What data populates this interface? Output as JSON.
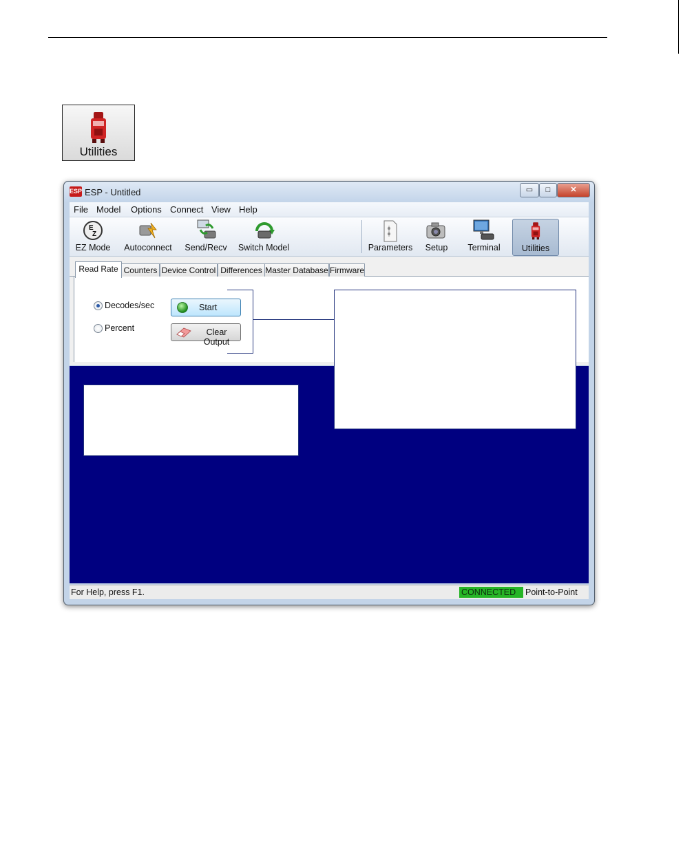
{
  "utilities_icon": {
    "label": "Utilities"
  },
  "window": {
    "title": "ESP - Untitled",
    "app_icon_text": "ESP",
    "controls": {
      "minimize": "▭",
      "maximize": "□",
      "close": "✕"
    }
  },
  "menu": {
    "items": [
      {
        "label": "File"
      },
      {
        "label": "Model"
      },
      {
        "label": "Options"
      },
      {
        "label": "Connect"
      },
      {
        "label": "View"
      },
      {
        "label": "Help"
      }
    ]
  },
  "toolbar": {
    "buttons": [
      {
        "label": "EZ Mode",
        "icon": "ez-mode-icon"
      },
      {
        "label": "Autoconnect",
        "icon": "autoconnect-icon"
      },
      {
        "label": "Send/Recv",
        "icon": "send-recv-icon"
      },
      {
        "label": "Switch Model",
        "icon": "switch-model-icon"
      },
      {
        "label": "Parameters",
        "icon": "parameters-icon"
      },
      {
        "label": "Setup",
        "icon": "setup-camera-icon"
      },
      {
        "label": "Terminal",
        "icon": "terminal-icon"
      },
      {
        "label": "Utilities",
        "icon": "utilities-icon",
        "active": true
      }
    ]
  },
  "tabs": [
    {
      "label": "Read Rate",
      "selected": true
    },
    {
      "label": "Counters"
    },
    {
      "label": "Device Control"
    },
    {
      "label": "Differences"
    },
    {
      "label": "Master Database"
    },
    {
      "label": "Firmware"
    }
  ],
  "read_rate": {
    "options": [
      {
        "label": "Decodes/sec",
        "selected": true
      },
      {
        "label": "Percent",
        "selected": false
      }
    ],
    "start_label": "Start",
    "clear_label": "Clear Output"
  },
  "status": {
    "help_text": "For Help, press F1.",
    "connection": "CONNECTED",
    "mode": "Point-to-Point",
    "connection_color": "#26b526"
  },
  "colors": {
    "output_bg": "#000080",
    "callout_border": "#1f2f7a"
  }
}
